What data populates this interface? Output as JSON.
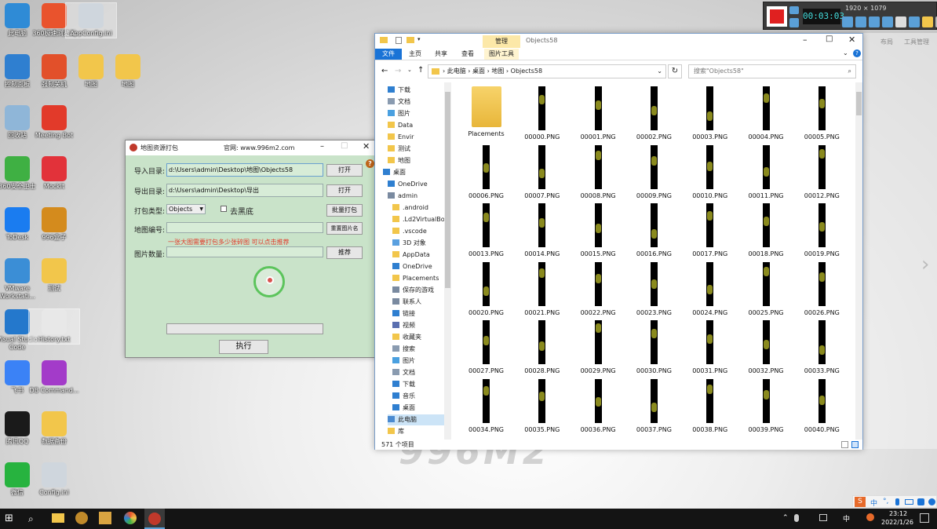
{
  "desktop": {
    "icons": [
      {
        "label": "此电脑",
        "color": "#2f8bd6",
        "icon": "computer-icon"
      },
      {
        "label": "360极速浏览器",
        "color": "#e9532d",
        "icon": "browser-icon"
      },
      {
        "label": "AppConfig.ini",
        "color": "#cfd6dd",
        "icon": "config-file-icon"
      },
      {
        "label": "控制面板",
        "color": "#2f7fd0",
        "icon": "control-panel-icon"
      },
      {
        "label": "强制关机",
        "color": "#e2502a",
        "icon": "shutdown-icon"
      },
      {
        "label": "地图",
        "color": "#f2c64b",
        "icon": "folder-icon"
      },
      {
        "label": "地图",
        "color": "#f2c64b",
        "icon": "folder-icon"
      },
      {
        "label": "回收站",
        "color": "#8fb6d8",
        "icon": "recycle-bin-icon"
      },
      {
        "label": "Meeting Bot",
        "color": "#e23a2a",
        "icon": "meeting-icon"
      },
      {
        "label": "360安全卫士",
        "color": "#3fb043",
        "icon": "security-icon"
      },
      {
        "label": "MockIt",
        "color": "#e2323a",
        "icon": "mockit-icon"
      },
      {
        "label": "ToDesk",
        "color": "#1a7cf0",
        "icon": "todesk-icon"
      },
      {
        "label": "996盒子",
        "color": "#d48b1d",
        "icon": "box-icon"
      },
      {
        "label": "VMware Workstati...",
        "color": "#3b8ed6",
        "icon": "vmware-icon"
      },
      {
        "label": "测试",
        "color": "#f2c64b",
        "icon": "folder-icon"
      },
      {
        "label": "Visual Studio Code",
        "color": "#2478cc",
        "icon": "vscode-icon"
      },
      {
        "label": "History.txt",
        "color": "#e8e8e8",
        "icon": "text-file-icon"
      },
      {
        "label": "飞书",
        "color": "#3b82f6",
        "icon": "feishu-icon"
      },
      {
        "label": "DB Command...",
        "color": "#a33bc9",
        "icon": "db-icon"
      },
      {
        "label": "腾讯QQ",
        "color": "#1a1a1a",
        "icon": "qq-icon"
      },
      {
        "label": "数据备份",
        "color": "#f2c64b",
        "icon": "folder-icon"
      },
      {
        "label": "微信",
        "color": "#27b33f",
        "icon": "wechat-icon"
      },
      {
        "label": "Config.ini",
        "color": "#cfd6dd",
        "icon": "config-file-icon"
      }
    ],
    "watermark": "996M2"
  },
  "recorder": {
    "timer": "00:03:03",
    "resolution": "1920 × 1079"
  },
  "dialog": {
    "title": "地图资源打包",
    "website": "官网: www.996m2.com",
    "import_label": "导入目录:",
    "import_value": "d:\\Users\\admin\\Desktop\\地图\\Objects58",
    "export_label": "导出目录:",
    "export_value": "d:\\Users\\admin\\Desktop\\导出",
    "open_label": "打开",
    "type_label": "打包类型:",
    "type_value": "Objects",
    "remove_black_label": "去黑底",
    "batch_pack_label": "批量打包",
    "map_id_label": "地图编号:",
    "rename_label": "重置图片名",
    "hint": "一张大图需要打包多少张碎图 可以点击推荐",
    "count_label": "图片数量:",
    "recommend_label": "推荐",
    "execute_label": "执行",
    "help": "?"
  },
  "explorer": {
    "title": "Objects58",
    "manage_tab": "管理",
    "ribbon_tabs": [
      "文件",
      "主页",
      "共享",
      "查看",
      "图片工具"
    ],
    "breadcrumb": [
      "此电脑",
      "桌面",
      "地图",
      "Objects58"
    ],
    "search_placeholder": "搜索\"Objects58\"",
    "nav_items": [
      {
        "label": "下载",
        "color": "#2f7fd0",
        "indent": 1
      },
      {
        "label": "文档",
        "color": "#8a9bb0",
        "indent": 1
      },
      {
        "label": "图片",
        "color": "#4aa0e0",
        "indent": 1
      },
      {
        "label": "Data",
        "color": "#f2c64b",
        "indent": 1
      },
      {
        "label": "Envir",
        "color": "#f2c64b",
        "indent": 1
      },
      {
        "label": "测试",
        "color": "#f2c64b",
        "indent": 1
      },
      {
        "label": "地图",
        "color": "#f2c64b",
        "indent": 1
      },
      {
        "label": "桌面",
        "color": "#2f7fd0",
        "indent": 0
      },
      {
        "label": "OneDrive",
        "color": "#2f7fd0",
        "indent": 1
      },
      {
        "label": "admin",
        "color": "#7a8aa0",
        "indent": 1
      },
      {
        "label": ".android",
        "color": "#f2c64b",
        "indent": 2
      },
      {
        "label": ".Ld2VirtualBo",
        "color": "#f2c64b",
        "indent": 2
      },
      {
        "label": ".vscode",
        "color": "#f2c64b",
        "indent": 2
      },
      {
        "label": "3D 对象",
        "color": "#5aa0e0",
        "indent": 2
      },
      {
        "label": "AppData",
        "color": "#f2c64b",
        "indent": 2
      },
      {
        "label": "OneDrive",
        "color": "#2f7fd0",
        "indent": 2
      },
      {
        "label": "Placements",
        "color": "#f2c64b",
        "indent": 2
      },
      {
        "label": "保存的游戏",
        "color": "#7a8aa0",
        "indent": 2
      },
      {
        "label": "联系人",
        "color": "#7a8aa0",
        "indent": 2
      },
      {
        "label": "链接",
        "color": "#2f7fd0",
        "indent": 2
      },
      {
        "label": "视频",
        "color": "#5a6fb0",
        "indent": 2
      },
      {
        "label": "收藏夹",
        "color": "#f2c64b",
        "indent": 2
      },
      {
        "label": "搜索",
        "color": "#8a9bb0",
        "indent": 2
      },
      {
        "label": "图片",
        "color": "#4aa0e0",
        "indent": 2
      },
      {
        "label": "文档",
        "color": "#8a9bb0",
        "indent": 2
      },
      {
        "label": "下载",
        "color": "#2f7fd0",
        "indent": 2
      },
      {
        "label": "音乐",
        "color": "#2f7fd0",
        "indent": 2
      },
      {
        "label": "桌面",
        "color": "#2f7fd0",
        "indent": 2
      },
      {
        "label": "此电脑",
        "color": "#4a8ad0",
        "indent": 1,
        "selected": true
      },
      {
        "label": "库",
        "color": "#f2c64b",
        "indent": 1
      }
    ],
    "files": [
      "Placements",
      "00000.PNG",
      "00001.PNG",
      "00002.PNG",
      "00003.PNG",
      "00004.PNG",
      "00005.PNG",
      "00006.PNG",
      "00007.PNG",
      "00008.PNG",
      "00009.PNG",
      "00010.PNG",
      "00011.PNG",
      "00012.PNG",
      "00013.PNG",
      "00014.PNG",
      "00015.PNG",
      "00016.PNG",
      "00017.PNG",
      "00018.PNG",
      "00019.PNG",
      "00020.PNG",
      "00021.PNG",
      "00022.PNG",
      "00023.PNG",
      "00024.PNG",
      "00025.PNG",
      "00026.PNG",
      "00027.PNG",
      "00028.PNG",
      "00029.PNG",
      "00030.PNG",
      "00031.PNG",
      "00032.PNG",
      "00033.PNG",
      "00034.PNG",
      "00035.PNG",
      "00036.PNG",
      "00037.PNG",
      "00038.PNG",
      "00039.PNG",
      "00040.PNG"
    ],
    "status": "571 个项目"
  },
  "right_panel": {
    "items": [
      "布局",
      "工具管理"
    ]
  },
  "taskbar": {
    "time": "23:12",
    "date": "2022/1/26",
    "ime": "中",
    "tray_ime": "中"
  }
}
